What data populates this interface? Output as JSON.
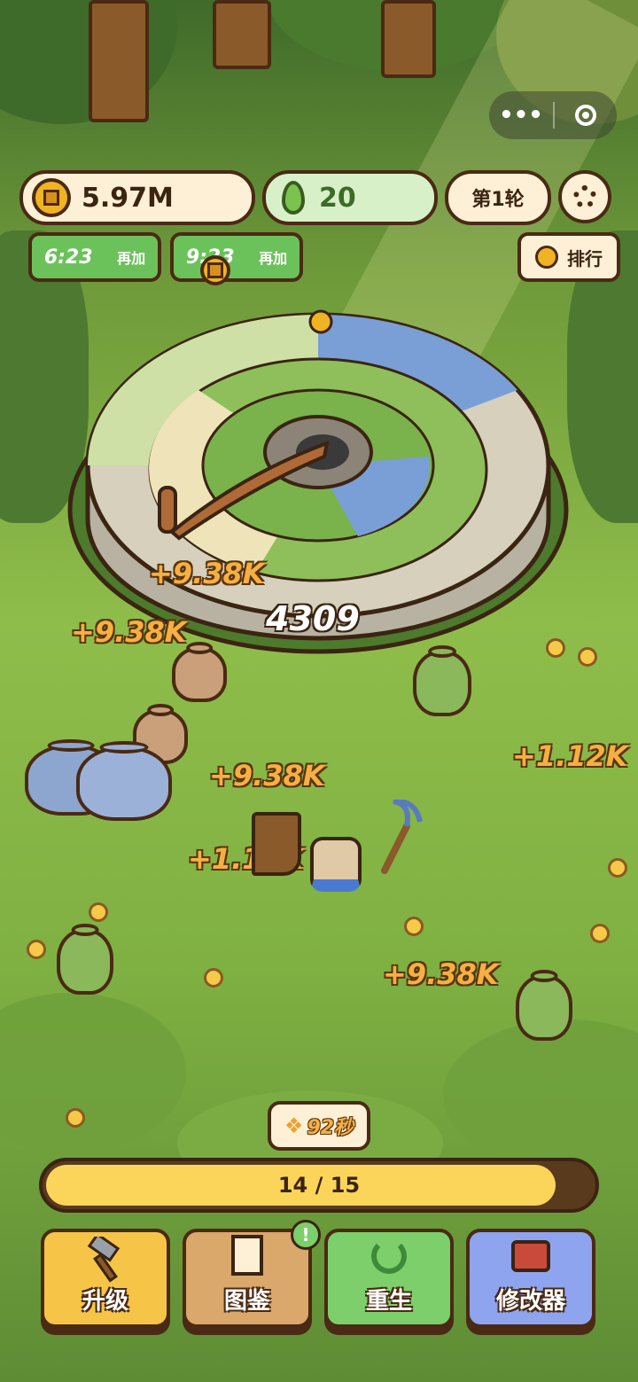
{
  "hud": {
    "coins": "5.97M",
    "seeds": "20",
    "round": "第1轮",
    "ranking": "排行",
    "timer1": "6:23",
    "timer1_action": "再加",
    "timer2": "9:23",
    "timer2_action": "再加"
  },
  "mill": {
    "count": "4309"
  },
  "floating": [
    "+9.38K",
    "+9.38K",
    "+9.38K",
    "+9.38K",
    "+1.12K",
    "+1.12K"
  ],
  "butterfly_timer": "92秒",
  "progress": {
    "label": "14 / 15",
    "current": 14,
    "total": 15
  },
  "bottom_nav": [
    {
      "label": "升级",
      "icon": "hammer-icon"
    },
    {
      "label": "图鉴",
      "icon": "book-icon",
      "badge": "!"
    },
    {
      "label": "重生",
      "icon": "rebirth-icon"
    },
    {
      "label": "修改器",
      "icon": "machine-icon"
    }
  ],
  "colors": {
    "coin": "#f0b323",
    "green_pill": "#6cc25a",
    "upgrade": "#f6c447",
    "book": "#d9a86a",
    "rebirth": "#7ccf6a",
    "modifier": "#8fa4ee"
  }
}
